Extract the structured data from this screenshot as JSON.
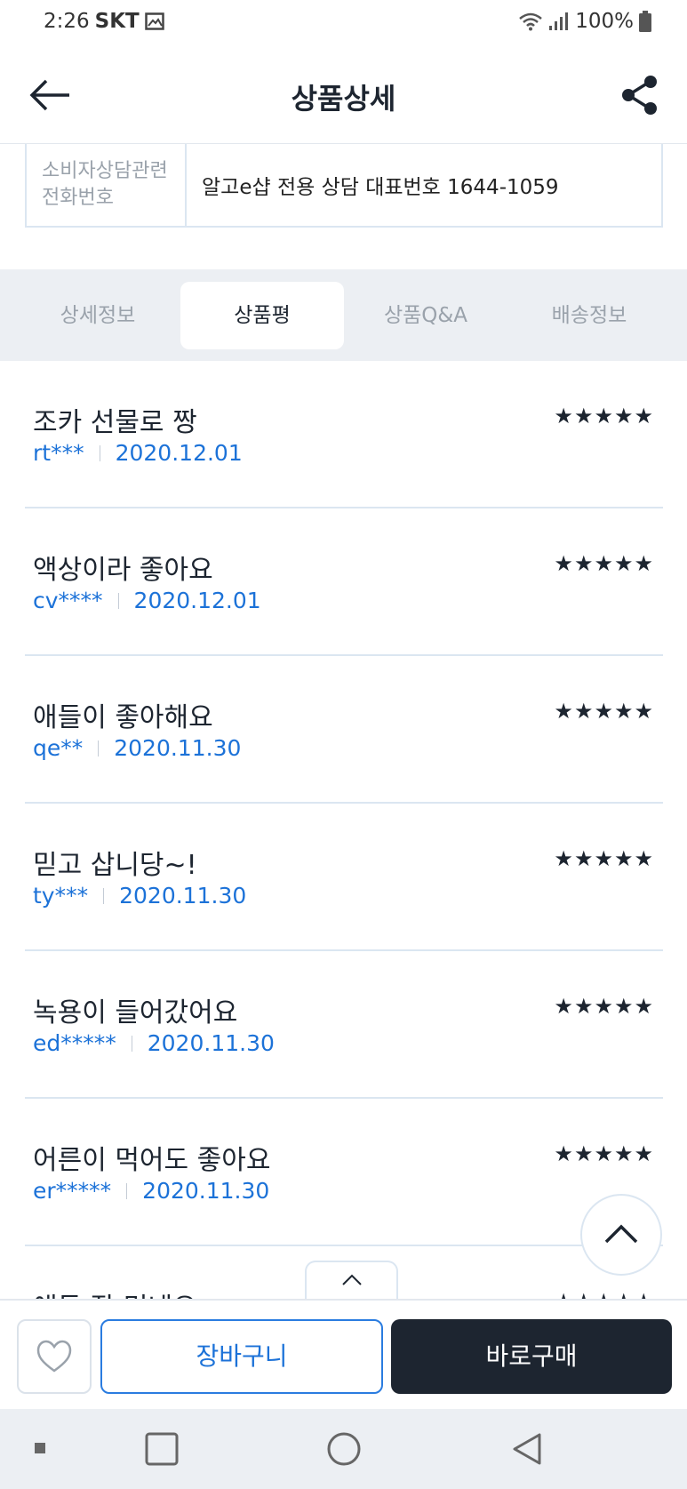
{
  "status_bar": {
    "time": "2:26",
    "carrier": "SKT",
    "battery": "100%"
  },
  "header": {
    "title": "상품상세"
  },
  "info": {
    "label": "소비자상담관련 전화번호",
    "value": "알고e샵 전용 상담 대표번호 1644-1059"
  },
  "tabs": [
    {
      "label": "상세정보",
      "active": false
    },
    {
      "label": "상품평",
      "active": true
    },
    {
      "label": "상품Q&A",
      "active": false
    },
    {
      "label": "배송정보",
      "active": false
    }
  ],
  "reviews": [
    {
      "title": "조카 선물로 짱",
      "user": "rt***",
      "date": "2020.12.01",
      "rating": 5
    },
    {
      "title": "액상이라 좋아요",
      "user": "cv****",
      "date": "2020.12.01",
      "rating": 5
    },
    {
      "title": "애들이 좋아해요",
      "user": "qe**",
      "date": "2020.11.30",
      "rating": 5
    },
    {
      "title": "믿고 삽니당~!",
      "user": "ty***",
      "date": "2020.11.30",
      "rating": 5
    },
    {
      "title": "녹용이 들어갔어요",
      "user": "ed*****",
      "date": "2020.11.30",
      "rating": 5
    },
    {
      "title": "어른이 먹어도 좋아요",
      "user": "er*****",
      "date": "2020.11.30",
      "rating": 5
    },
    {
      "title": "애들 잘 먹네요",
      "user": "",
      "date": "",
      "rating": 5
    }
  ],
  "stars_text": "★★★★★",
  "actions": {
    "cart_label": "장바구니",
    "buy_label": "바로구매"
  },
  "colors": {
    "accent_blue": "#1c72d8",
    "dark": "#1d2530",
    "border": "#dbe6f1",
    "tab_bg": "#eceff3"
  },
  "icons": [
    "image-icon",
    "wifi-icon",
    "signal-icon",
    "battery-icon",
    "back-arrow-icon",
    "share-icon",
    "chevron-up-icon",
    "heart-icon",
    "recent-apps-icon",
    "home-icon",
    "back-icon"
  ]
}
